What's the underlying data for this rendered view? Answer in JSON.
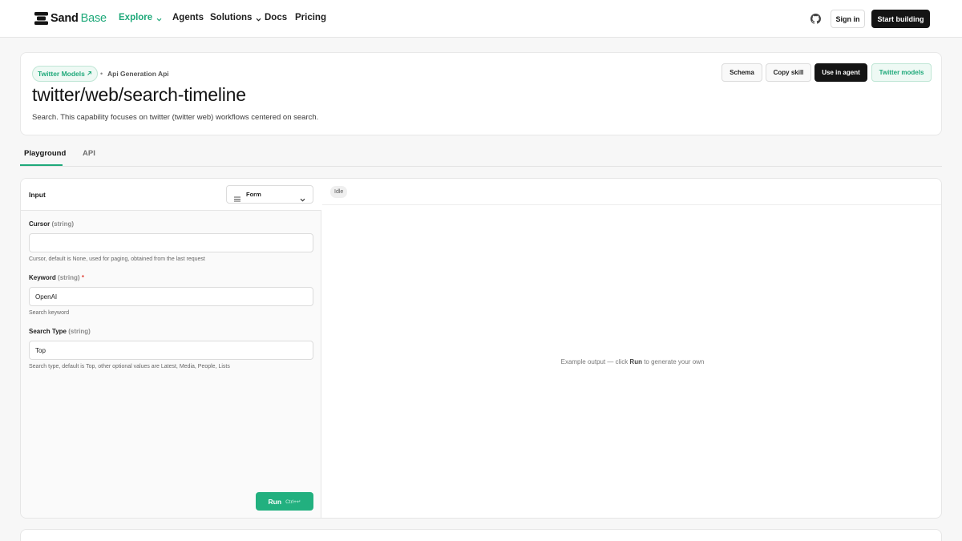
{
  "nav": {
    "logo_main": "Sand",
    "logo_accent": "Base",
    "items": [
      {
        "label": "Explore",
        "has_dropdown": true,
        "active": true
      },
      {
        "label": "Agents",
        "has_dropdown": false
      },
      {
        "label": "Solutions",
        "has_dropdown": true
      },
      {
        "label": "Docs",
        "has_dropdown": false
      },
      {
        "label": "Pricing",
        "has_dropdown": false
      }
    ],
    "github_icon": "github-icon",
    "sign_in": "Sign in",
    "start_building": "Start building"
  },
  "header": {
    "tag_label": "Twitter Models",
    "tag_icon": "arrow-up-right-icon",
    "crumb": "Api Generation Api",
    "title": "twitter/web/search-timeline",
    "description": "Search. This capability focuses on twitter (twitter web) workflows centered on search.",
    "buttons": {
      "schema": "Schema",
      "copy_skill": "Copy skill",
      "use_in_agent": "Use in agent",
      "twitter_models": "Twitter models"
    }
  },
  "tabs": [
    {
      "label": "Playground",
      "active": true
    },
    {
      "label": "API",
      "active": false
    }
  ],
  "input_panel": {
    "title": "Input",
    "mode": "Form",
    "fields": [
      {
        "name": "Cursor",
        "type": "(string)",
        "required": false,
        "value": "",
        "help": "Cursor, default is None, used for paging, obtained from the last request"
      },
      {
        "name": "Keyword",
        "type": "(string)",
        "required": true,
        "value": "OpenAI",
        "help": "Search keyword"
      },
      {
        "name": "Search Type",
        "type": "(string)",
        "required": false,
        "value": "Top",
        "help": "Search type, default is Top, other optional values are Latest, Media, People, Lists"
      }
    ],
    "required_mark": "*",
    "run_label": "Run",
    "run_shortcut": "Ctrl+↵"
  },
  "output_panel": {
    "status": "Idle",
    "hint_before": "Example output — click ",
    "hint_bold": "Run",
    "hint_after": " to generate your own"
  },
  "colors": {
    "accent": "#1fa97a",
    "dark": "#141414",
    "required": "#e0463c"
  }
}
